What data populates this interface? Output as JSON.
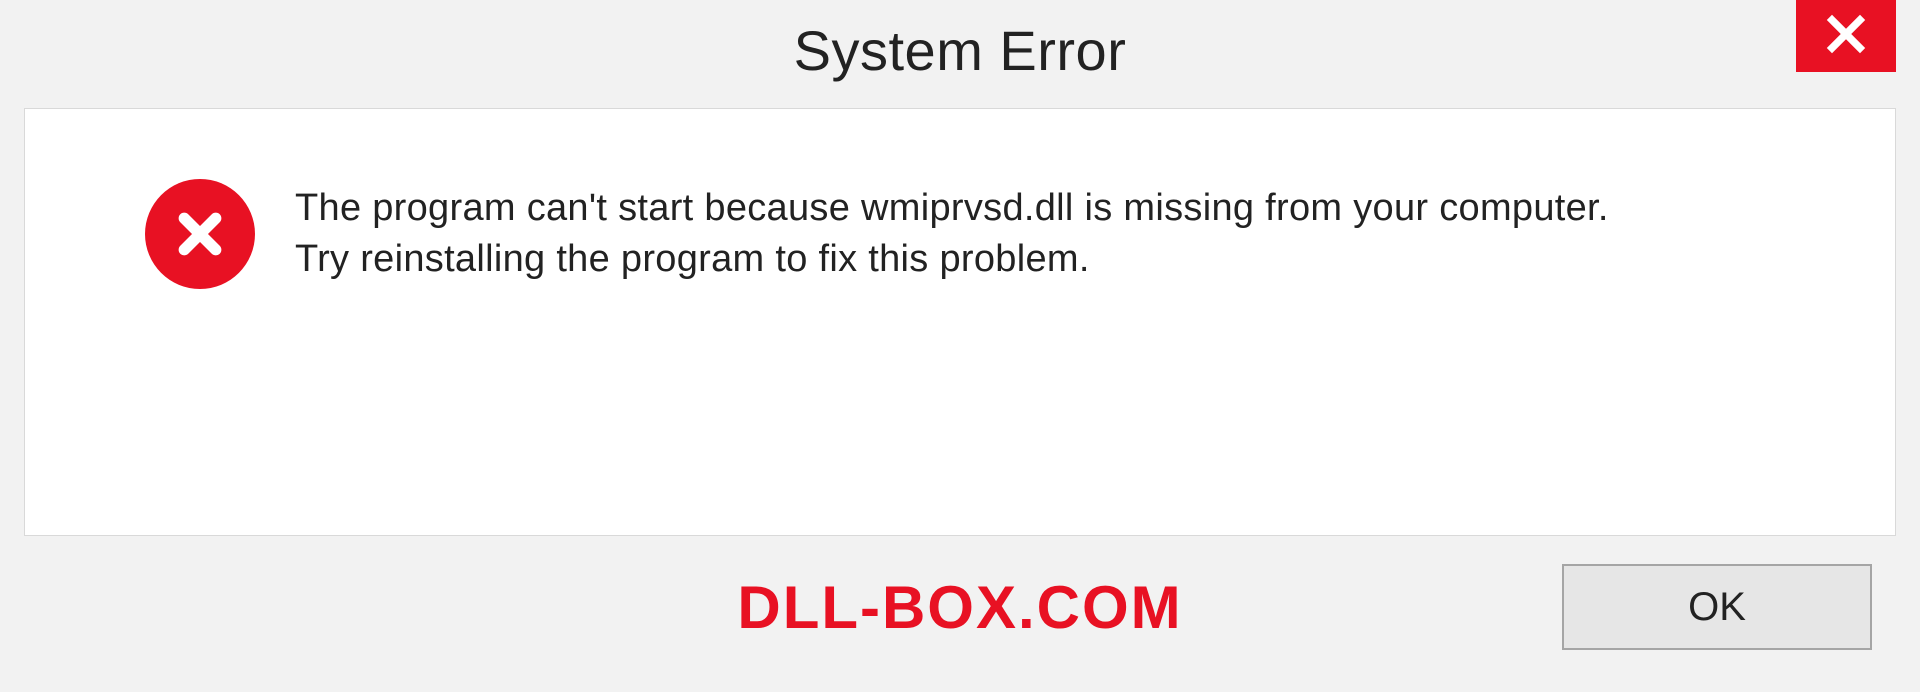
{
  "dialog": {
    "title": "System Error",
    "message_line1": "The program can't start because wmiprvsd.dll is missing from your computer.",
    "message_line2": "Try reinstalling the program to fix this problem.",
    "ok_label": "OK"
  },
  "watermark": "DLL-BOX.COM",
  "colors": {
    "error_red": "#e81123",
    "panel_bg": "#ffffff",
    "page_bg": "#f2f2f2",
    "border": "#d9d9d9",
    "button_bg": "#e6e6e6",
    "button_border": "#a5a5a5",
    "text": "#222222"
  },
  "icons": {
    "close": "close-icon",
    "error": "error-circle-x-icon"
  }
}
